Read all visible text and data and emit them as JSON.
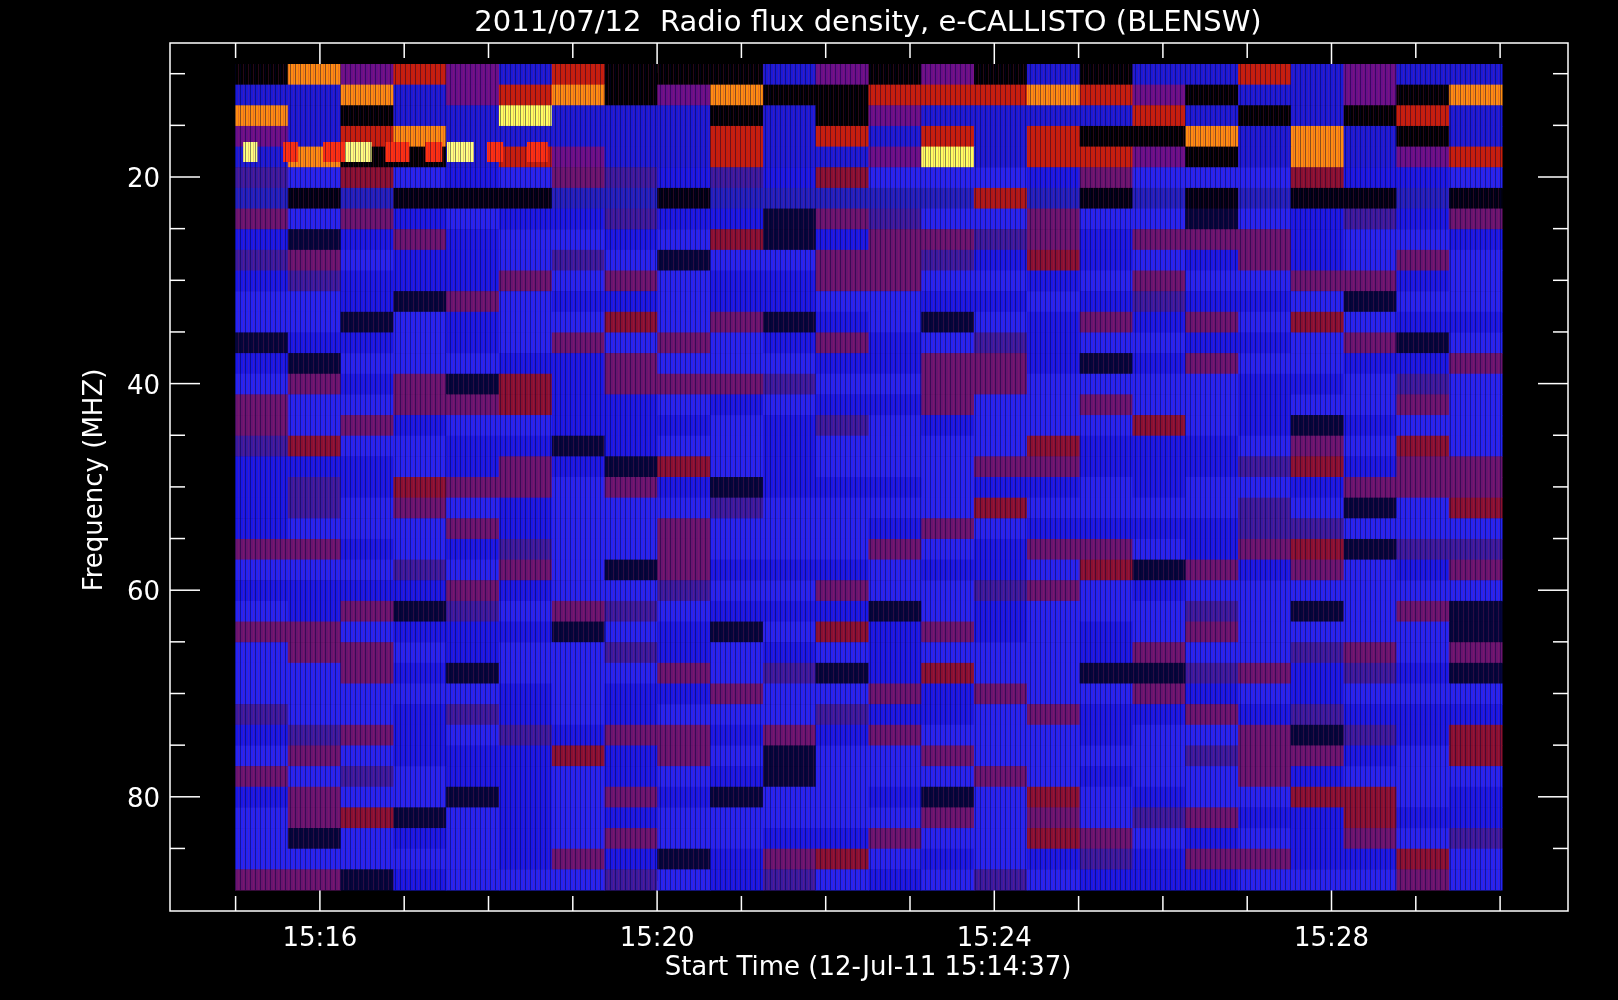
{
  "title": "2011/07/12  Radio flux density, e-CALLISTO (BLENSW)",
  "y_axis": {
    "label": "Frequency (MHZ)",
    "ticks": [
      "20",
      "40",
      "60",
      "80"
    ]
  },
  "x_axis": {
    "label": "Start Time (12-Jul-11 15:14:37)",
    "ticks": [
      "15:16",
      "15:20",
      "15:24",
      "15:28"
    ]
  }
}
